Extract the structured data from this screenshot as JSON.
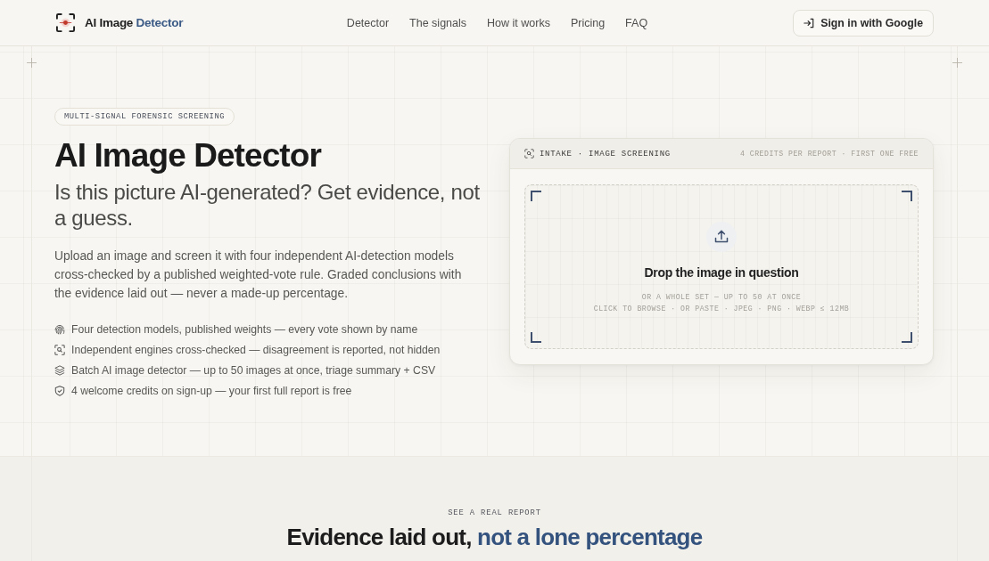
{
  "header": {
    "logo": {
      "text": "AI Image",
      "accent": "Detector"
    },
    "nav": [
      "Detector",
      "The signals",
      "How it works",
      "Pricing",
      "FAQ"
    ],
    "sign_in_button": "Sign in with Google"
  },
  "hero": {
    "badge": "MULTI-SIGNAL FORENSIC SCREENING",
    "title": "AI Image Detector",
    "subtitle": "Is this picture AI-generated? Get evidence, not a guess.",
    "description": "Upload an image and screen it with four independent AI-detection models cross-checked by a published weighted-vote rule. Graded conclusions with the evidence laid out — never a made-up percentage.",
    "features": [
      "Four detection models, published weights — every vote shown by name",
      "Independent engines cross-checked — disagreement is reported, not hidden",
      "Batch AI image detector — up to 50 images at once, triage summary + CSV",
      "4 welcome credits on sign-up — your first full report is free"
    ]
  },
  "intake_card": {
    "header_label": "INTAKE · IMAGE SCREENING",
    "header_note": "4 CREDITS PER REPORT · FIRST ONE FREE",
    "dropzone": {
      "title": "Drop the image in question",
      "lines": [
        "OR A WHOLE SET — UP TO 50 AT ONCE",
        "CLICK TO BROWSE · OR PASTE · JPEG · PNG · WEBP ≤ 12MB"
      ]
    }
  },
  "report_section": {
    "eyebrow": "SEE A REAL REPORT",
    "title": "Evidence laid out,",
    "title_accent": "not a lone percentage"
  }
}
